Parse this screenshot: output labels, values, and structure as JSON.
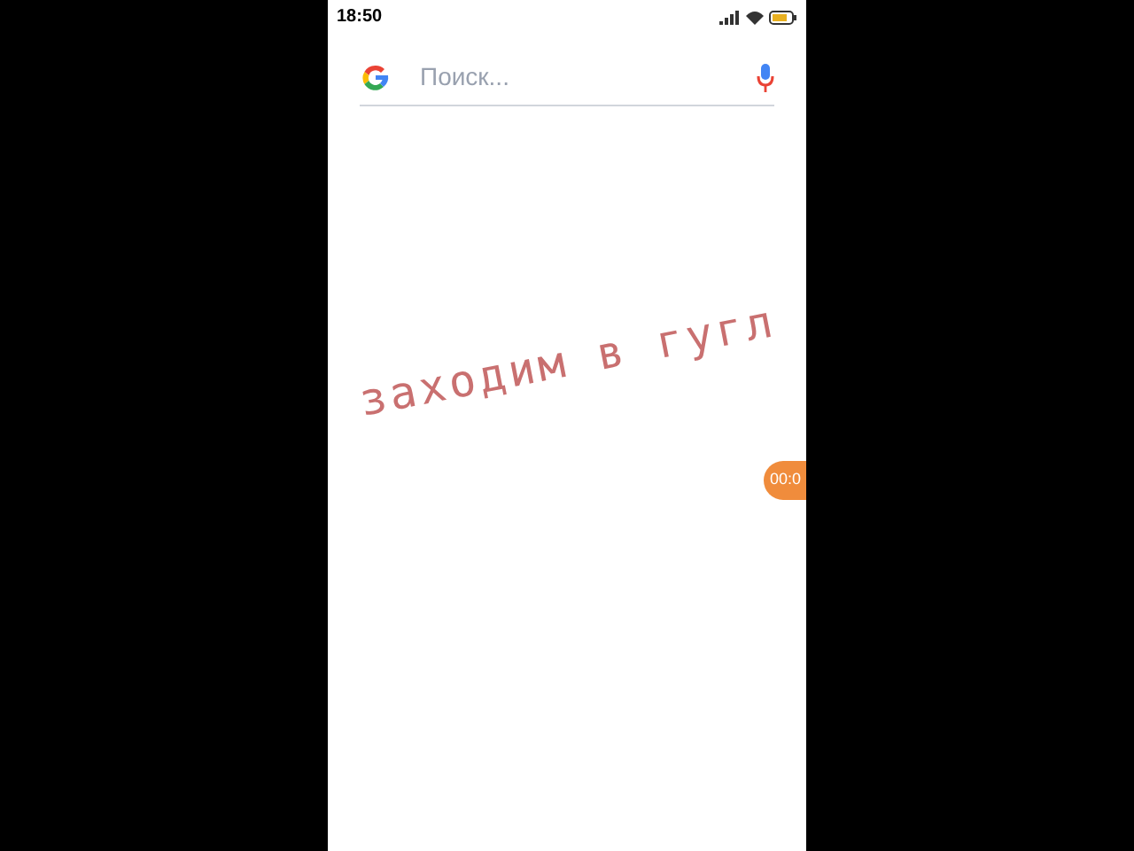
{
  "status_bar": {
    "time": "18:50"
  },
  "search": {
    "placeholder": "Поиск..."
  },
  "caption": "заходим в гугл",
  "recorder_bubble": {
    "timer": "00:0"
  }
}
